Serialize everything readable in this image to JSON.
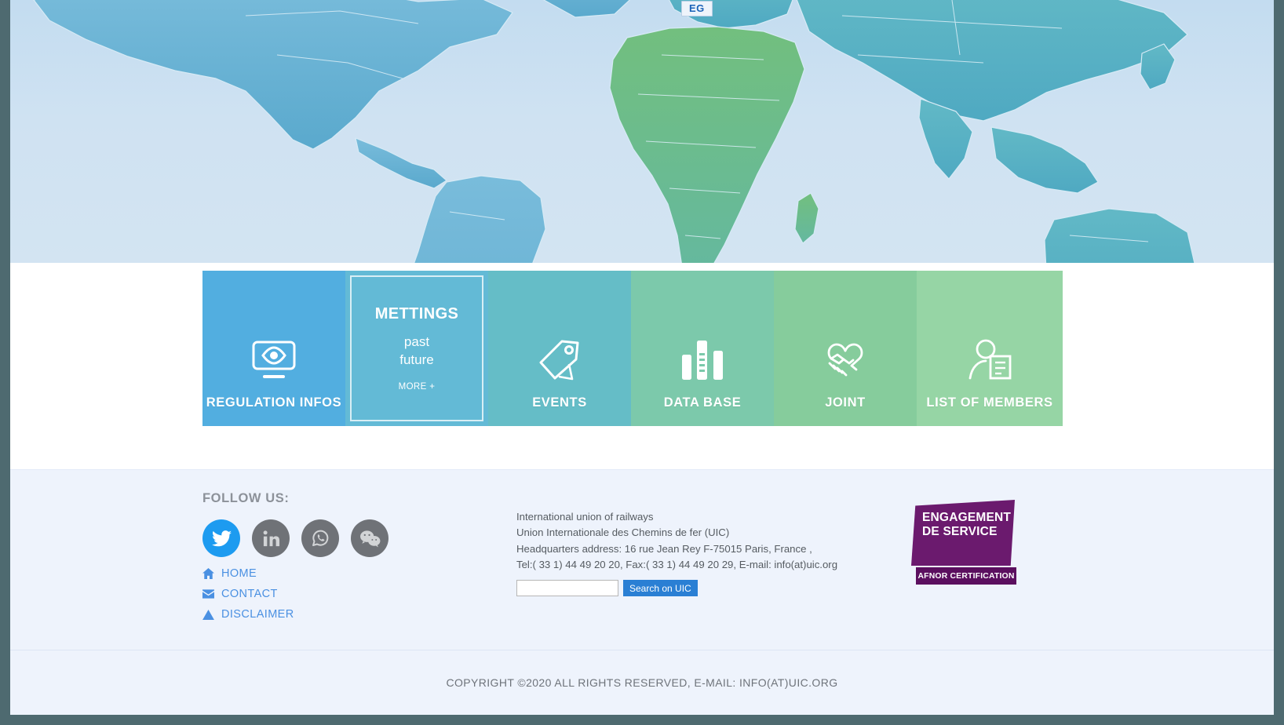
{
  "map": {
    "tooltip_label": "EG",
    "ocean_color": "#cfe2f2",
    "americas_color": "#5fa8cf",
    "africa_color": "#6fbb7e",
    "asia_color": "#54b0c4",
    "oceania_color": "#4fa9c4"
  },
  "tiles": [
    {
      "label": "REGULATION INFOS",
      "icon": "eye-monitor-icon",
      "color": "#52aee0"
    },
    {
      "label": "METTINGS",
      "icon": "",
      "color": "#63bad6",
      "sub_past": "past",
      "sub_future": "future",
      "more": "MORE +"
    },
    {
      "label": "EVENTS",
      "icon": "tags-icon",
      "color": "#65bdc7"
    },
    {
      "label": "DATA BASE",
      "icon": "bar-chart-icon",
      "color": "#7cc9ab"
    },
    {
      "label": "JOINT",
      "icon": "handshake-heart-icon",
      "color": "#86cc9c"
    },
    {
      "label": "LIST OF MEMBERS",
      "icon": "person-document-icon",
      "color": "#96d5a5"
    }
  ],
  "footer": {
    "follow_title": "FOLLOW US:",
    "socials": [
      {
        "name": "twitter-icon",
        "color": "#1d9bf0"
      },
      {
        "name": "linkedin-icon",
        "color": "#6f7277"
      },
      {
        "name": "whatsapp-icon",
        "color": "#6f7277"
      },
      {
        "name": "wechat-icon",
        "color": "#6f7277"
      }
    ],
    "nav": [
      {
        "label": "HOME",
        "icon": "home-icon"
      },
      {
        "label": "CONTACT",
        "icon": "envelope-icon"
      },
      {
        "label": "DISCLAIMER",
        "icon": "warning-triangle-icon"
      }
    ],
    "address": [
      "International union of railways",
      "Union Internationale des Chemins de fer (UIC)",
      "Headquarters address: 16 rue Jean Rey F-75015 Paris, France ,",
      "Tel:( 33 1) 44 49 20 20, Fax:( 33 1) 44 49 20 29, E-mail: info(at)uic.org"
    ],
    "search": {
      "value": "",
      "placeholder": "",
      "button_label": "Search on UIC"
    },
    "badge": {
      "line1": "ENGAGEMENT",
      "line2": "DE SERVICE",
      "certification": "AFNOR CERTIFICATION"
    }
  },
  "copyright": "COPYRIGHT ©2020  ALL RIGHTS RESERVED, E-MAIL: INFO(AT)UIC.ORG"
}
